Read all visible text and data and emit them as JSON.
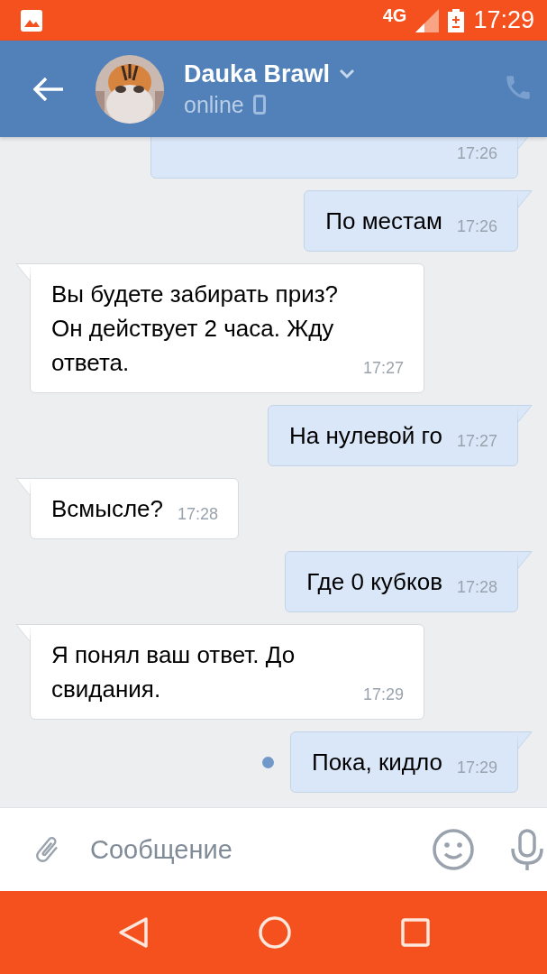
{
  "status_bar": {
    "network": "4G",
    "time": "17:29"
  },
  "header": {
    "name": "Dauka Brawl",
    "status": "online"
  },
  "messages": [
    {
      "kind": "outgoing",
      "time": "17:26",
      "unread": false
    },
    {
      "kind": "outgoing",
      "text": "По местам",
      "time": "17:26",
      "unread": false
    },
    {
      "kind": "incoming",
      "text": "Вы будете забирать приз? Он действует 2 часа. Жду ответа.",
      "time": "17:27",
      "unread": false
    },
    {
      "kind": "outgoing",
      "text": "На нулевой го",
      "time": "17:27",
      "unread": false
    },
    {
      "kind": "incoming",
      "text": "Всмысле?",
      "time": "17:28",
      "unread": false
    },
    {
      "kind": "outgoing",
      "text": "Где 0 кубков",
      "time": "17:28",
      "unread": false
    },
    {
      "kind": "incoming",
      "text": "Я понял ваш ответ. До свидания.",
      "time": "17:29",
      "unread": false
    },
    {
      "kind": "outgoing",
      "text": "Пока, кидло",
      "time": "17:29",
      "unread": true
    }
  ],
  "composer": {
    "placeholder": "Сообщение"
  }
}
